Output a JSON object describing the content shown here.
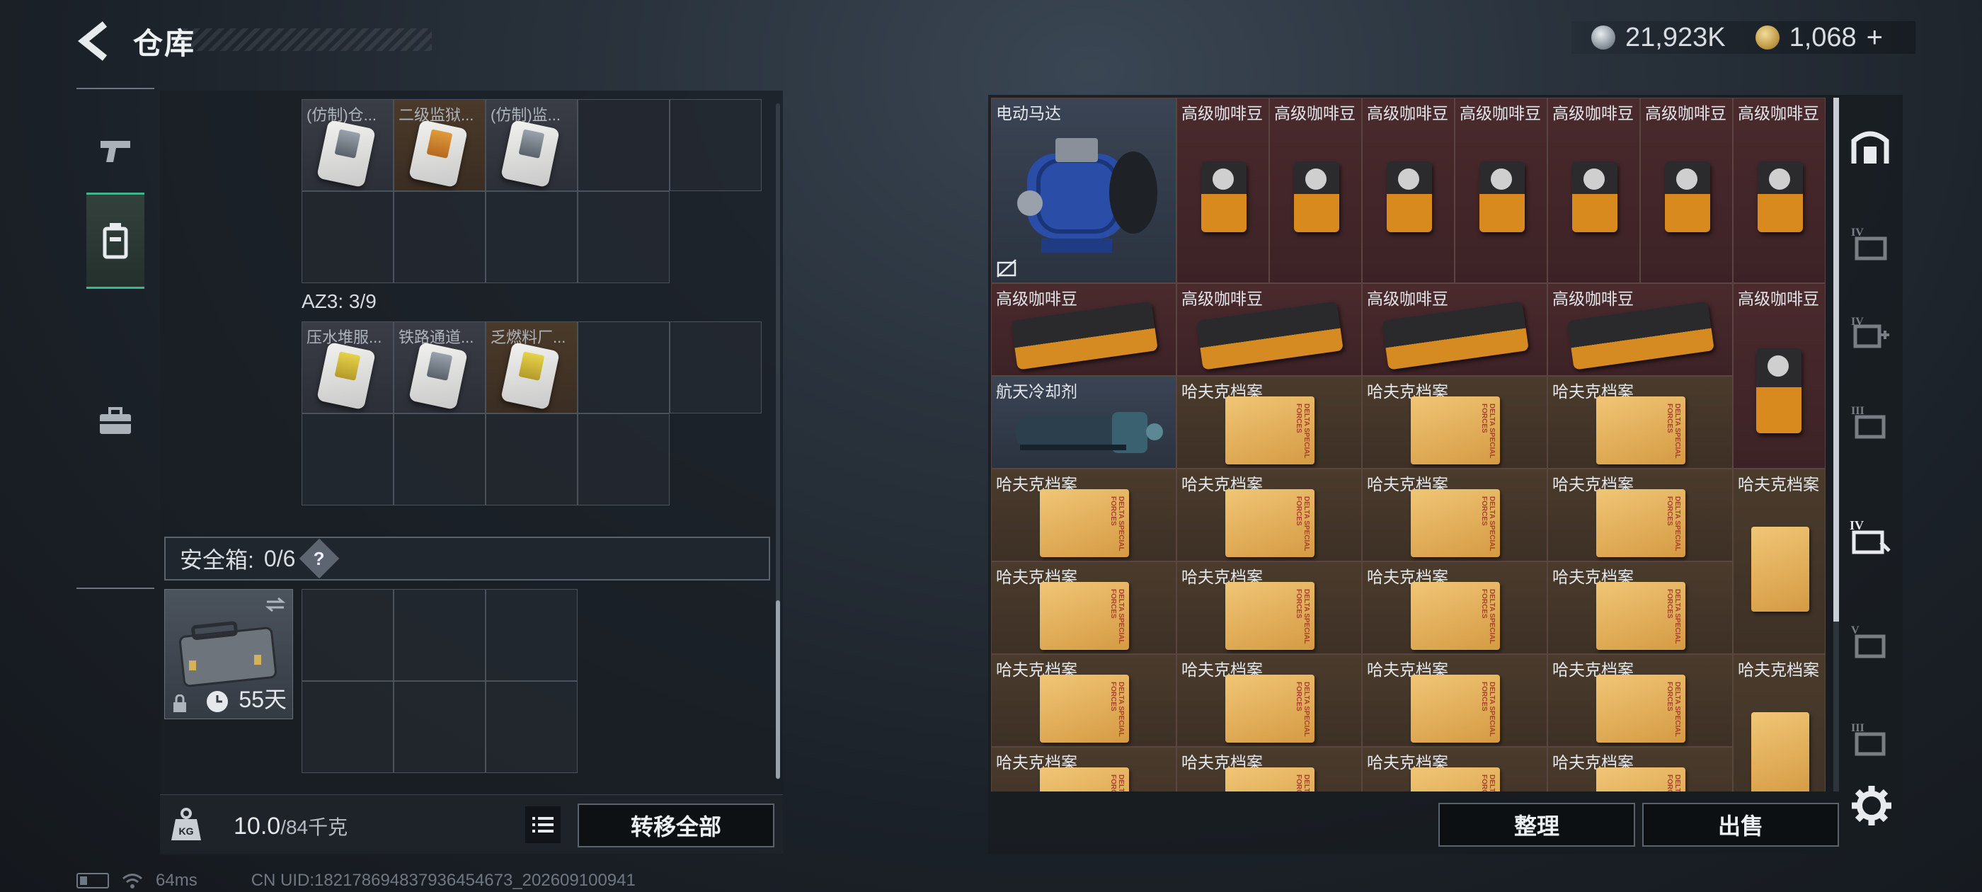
{
  "header": {
    "title": "仓库"
  },
  "currency": {
    "silver": "21,923K",
    "gold": "1,068",
    "gold_plus": "+"
  },
  "left_rail": {
    "items": [
      "weapon",
      "armor",
      "container",
      "toolbox"
    ]
  },
  "left_panel": {
    "top_slots": [
      "(仿制)仓...",
      "二级监狱...",
      "(仿制)监..."
    ],
    "az3_label": "AZ3: 3/9",
    "az3_slots": [
      "压水堆服...",
      "铁路通道...",
      "乏燃料厂..."
    ],
    "safe_box": {
      "label": "安全箱:",
      "count": "0/6",
      "help": "?",
      "days": "55天"
    },
    "weight": {
      "current": "10.0",
      "max": "/84千克"
    },
    "transfer_all": "转移全部"
  },
  "status_bar": {
    "ping": "64ms",
    "uid": "CN UID:18217869483793645467​3_202609100941"
  },
  "stash": {
    "motor": "电动马达",
    "coffee": "高级咖啡豆",
    "coolant": "航天冷却剂",
    "file": "哈夫克档案"
  },
  "actions": {
    "sort": "整理",
    "sell": "出售"
  },
  "colors": {
    "accent_green": "#3fb58b",
    "item_red": "#4a2a2d",
    "item_brown": "#4a3b2c"
  }
}
